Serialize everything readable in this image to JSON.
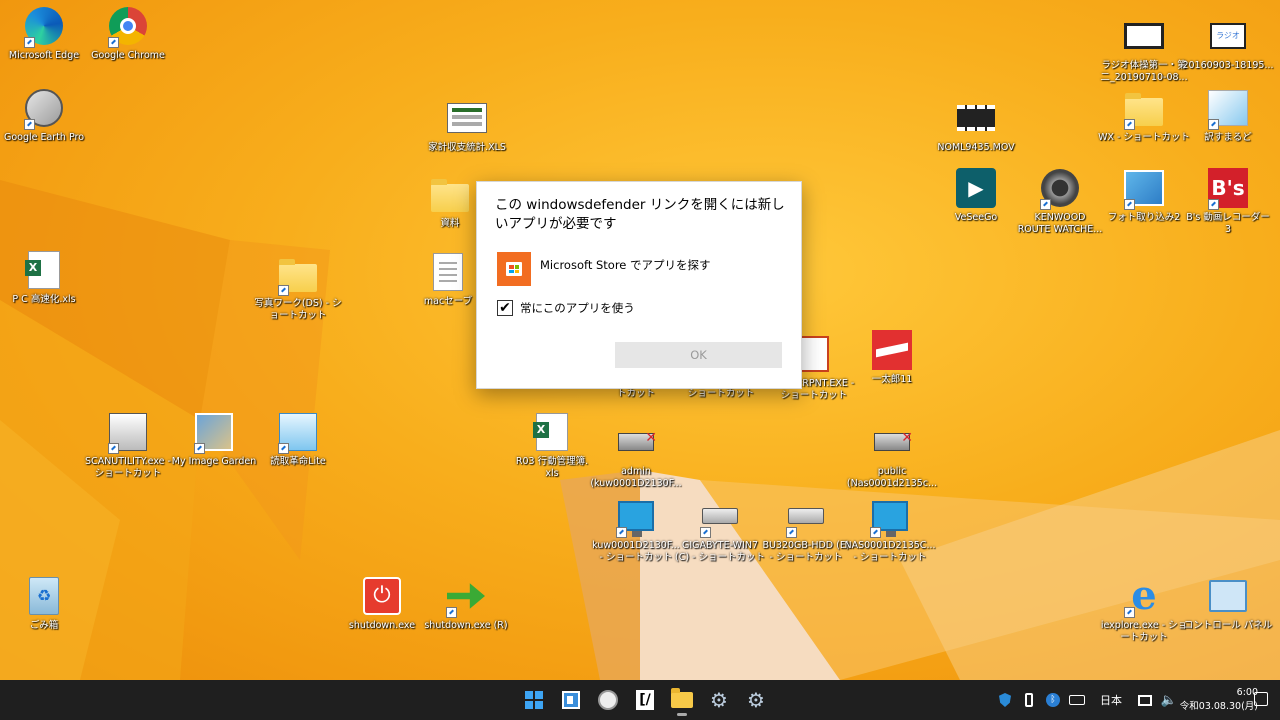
{
  "desktop": {
    "icons": [
      {
        "label": "Microsoft Edge"
      },
      {
        "label": "Google Chrome"
      },
      {
        "label": "Google Earth Pro"
      },
      {
        "label": "家計収支統計.XLS"
      },
      {
        "label": "NOML9435.MOV"
      },
      {
        "label": "WX - ショートカット"
      },
      {
        "label": "訳すまるど"
      },
      {
        "label": "ラジオ体操第一・第\n二_20190710-08..."
      },
      {
        "label": "20160903-18195..."
      },
      {
        "label": "資料"
      },
      {
        "label": "VeSeeGo"
      },
      {
        "label": "KENWOOD\nROUTE WATCHE..."
      },
      {
        "label": "フォト取り込み2"
      },
      {
        "label": "B's 動画レコーダー 3"
      },
      {
        "label": "P C 高速化.xls"
      },
      {
        "label": "写真ワーク(DS) - シ\nョートカット"
      },
      {
        "label": "macセーブ"
      },
      {
        "label": "トカット"
      },
      {
        "label": "ショートカット"
      },
      {
        "label": "POWERPNT.EXE -\nショートカット"
      },
      {
        "label": "一太郎11"
      },
      {
        "label": "SCANUTILITY.exe -\nショートカット"
      },
      {
        "label": "My Image Garden"
      },
      {
        "label": "読取革命Lite"
      },
      {
        "label": "R03 行動管理簿.\nxls"
      },
      {
        "label": "admin\n(kuw0001D2130F..."
      },
      {
        "label": "public\n(Nas0001d2135c..."
      },
      {
        "label": "kuw0001D2130F...\n- ショートカット"
      },
      {
        "label": "GIGABYTE-WIN7\n(C) - ショートカット"
      },
      {
        "label": "BU320GB-HDD (E)\n- ショートカット"
      },
      {
        "label": "NAS0001D2135C...\n- ショートカット"
      },
      {
        "label": "ごみ箱"
      },
      {
        "label": "shutdown.exe"
      },
      {
        "label": "shutdown.exe (R)"
      },
      {
        "label": "iexplore.exe - ショ\nートカット"
      },
      {
        "label": "コントロール パネル"
      }
    ]
  },
  "dialog": {
    "title": "この windowsdefender リンクを開くには新しいアプリが必要です",
    "store_option": "Microsoft Store でアプリを探す",
    "always_use_label": "常にこのアプリを使う",
    "always_use_checked": "✔",
    "ok_label": "OK"
  },
  "taskbar": {
    "ime_label": "日本",
    "time": "6:00",
    "date": "令和03.08.30(月)"
  },
  "colors": {
    "wallpaper": "#f6a71a",
    "taskbar": "#1f1f1f",
    "store_tile": "#f26d21",
    "ok_button_bg": "#e6e6e6"
  }
}
